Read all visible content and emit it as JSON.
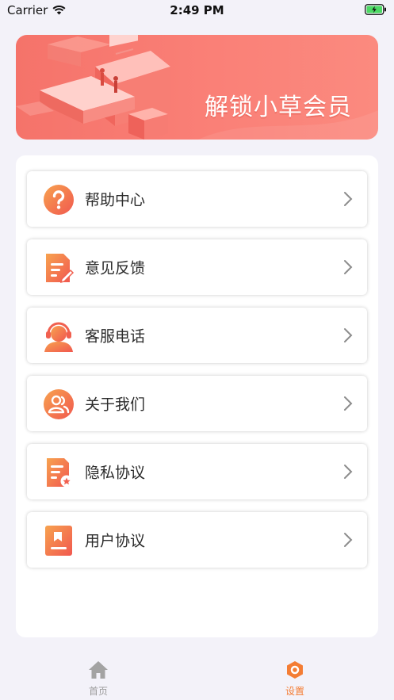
{
  "status_bar": {
    "carrier": "Carrier",
    "time": "2:49 PM"
  },
  "banner": {
    "title": "解锁小草会员"
  },
  "menu": {
    "items": [
      {
        "label": "帮助中心",
        "icon": "question-circle-icon"
      },
      {
        "label": "意见反馈",
        "icon": "feedback-document-icon"
      },
      {
        "label": "客服电话",
        "icon": "customer-service-headset-icon"
      },
      {
        "label": "关于我们",
        "icon": "users-circle-icon"
      },
      {
        "label": "隐私协议",
        "icon": "privacy-document-icon"
      },
      {
        "label": "用户协议",
        "icon": "user-agreement-book-icon"
      }
    ]
  },
  "tab_bar": {
    "tabs": [
      {
        "label": "首页",
        "icon": "home-icon",
        "active": false
      },
      {
        "label": "设置",
        "icon": "settings-hexagon-icon",
        "active": true
      }
    ]
  },
  "colors": {
    "accent": "#f47d34",
    "icon_gradient_start": "#f59a4c",
    "icon_gradient_end": "#f2604f",
    "banner": "#f87a70"
  }
}
